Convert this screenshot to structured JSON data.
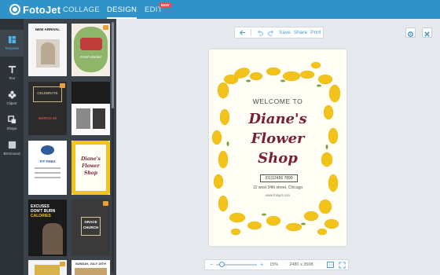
{
  "app": {
    "logo_text": "FotoJet"
  },
  "nav": {
    "tabs": [
      {
        "label": "COLLAGE"
      },
      {
        "label": "DESIGN"
      },
      {
        "label": "EDIT"
      }
    ],
    "new_badge": "NEW",
    "active": "DESIGN"
  },
  "sidebar": {
    "items": [
      {
        "label": "Template",
        "icon": "template-icon",
        "active": true
      },
      {
        "label": "Text",
        "icon": "text-icon"
      },
      {
        "label": "Clipart",
        "icon": "clipart-icon"
      },
      {
        "label": "Shape",
        "icon": "shape-icon"
      },
      {
        "label": "BKGround",
        "icon": "background-icon"
      }
    ]
  },
  "templates": {
    "items": [
      {
        "lines": [
          "NEW ARRIVAL"
        ]
      },
      {
        "lines": [
          "Fresh Market"
        ]
      },
      {
        "lines": [
          "CELEBRATE",
          "MARCH 20"
        ]
      },
      {
        "lines": [
          ""
        ]
      },
      {
        "lines": [
          "FIT FEBS"
        ]
      },
      {
        "lines": [
          "Diane's",
          "Flower",
          "Shop"
        ]
      },
      {
        "lines": [
          "EXCUSES",
          "DON'T BURN",
          "CALORIES"
        ]
      },
      {
        "lines": [
          "GRACE",
          "CHURCH"
        ]
      },
      {
        "lines": [
          ""
        ]
      },
      {
        "lines": [
          "SUNDAY, JULY 15TH"
        ]
      }
    ]
  },
  "toolbar": {
    "save": "Save",
    "share": "Share",
    "print": "Print"
  },
  "poster": {
    "welcome": "WELCOME TO",
    "title1": "Diane's",
    "title2": "Flower",
    "title3": "Shop",
    "phone": "(01)12456 7890",
    "address": "12 west 34th street, Chicago",
    "website": "www.fotojet.com"
  },
  "zoom": {
    "percent": "15%",
    "dimensions": "2480 x 3508",
    "level": 0.15
  },
  "colors": {
    "accent": "#2f93c9",
    "title": "#7a1f3b",
    "flower": "#f2c31a"
  }
}
